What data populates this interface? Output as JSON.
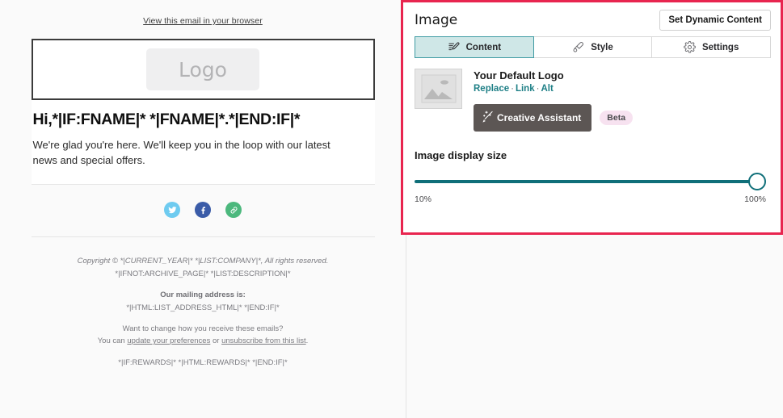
{
  "email_preview": {
    "browser_link": "View this email in your browser",
    "logo_placeholder": "Logo",
    "greeting_title": "Hi,*|IF:FNAME|* *|FNAME|*.*|END:IF|*",
    "greeting_body": "We're glad you're here. We'll keep you in the loop with our latest news and special offers.",
    "social": [
      {
        "name": "twitter",
        "color": "#6ecbf0"
      },
      {
        "name": "facebook",
        "color": "#3b5ca8"
      },
      {
        "name": "link",
        "color": "#4cb87d"
      }
    ],
    "footer": {
      "copyright": "Copyright © *|CURRENT_YEAR|* *|LIST:COMPANY|*, All rights reserved.",
      "archive": "*|IFNOT:ARCHIVE_PAGE|* *|LIST:DESCRIPTION|*",
      "mailing_heading": "Our mailing address is:",
      "mailing_value": "*|HTML:LIST_ADDRESS_HTML|* *|END:IF|*",
      "preferences_question": "Want to change how you receive these emails?",
      "preferences_prefix": "You can ",
      "preferences_link": "update your preferences",
      "preferences_middle": " or ",
      "unsubscribe_link": "unsubscribe from this list",
      "preferences_suffix": ".",
      "rewards": "*|IF:REWARDS|* *|HTML:REWARDS|* *|END:IF|*"
    }
  },
  "editor": {
    "title": "Image",
    "dynamic_content_button": "Set Dynamic Content",
    "accent_color": "#e8254f",
    "teal_color": "#0f6f79",
    "tabs": [
      {
        "label": "Content",
        "icon": "pencil-edit-icon",
        "active": true
      },
      {
        "label": "Style",
        "icon": "paint-brush-icon",
        "active": false
      },
      {
        "label": "Settings",
        "icon": "gear-icon",
        "active": false
      }
    ],
    "media": {
      "title": "Your Default Logo",
      "replace_link": "Replace",
      "link_link": "Link",
      "alt_link": "Alt",
      "separator": "·"
    },
    "creative_assistant": {
      "label": "Creative Assistant",
      "badge": "Beta",
      "icon": "magic-wand-icon"
    },
    "image_display_size": {
      "label": "Image display size",
      "min_label": "10%",
      "max_label": "100%",
      "value": 100
    }
  }
}
